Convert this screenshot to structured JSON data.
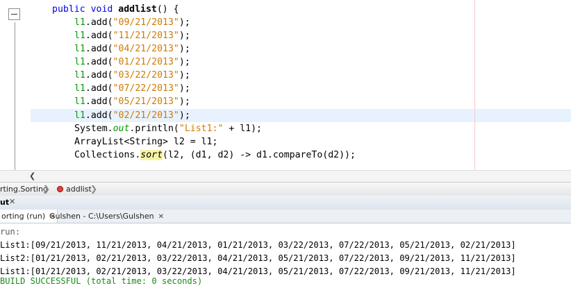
{
  "editor": {
    "lines": [
      {
        "indent": "    ",
        "modifiers": "public void ",
        "method_name": "addlist",
        "rest": "() {"
      },
      {
        "receiver": "l1",
        "call": ".add(",
        "arg": "\"09/21/2013\"",
        "end": ");"
      },
      {
        "receiver": "l1",
        "call": ".add(",
        "arg": "\"11/21/2013\"",
        "end": ");"
      },
      {
        "receiver": "l1",
        "call": ".add(",
        "arg": "\"04/21/2013\"",
        "end": ");"
      },
      {
        "receiver": "l1",
        "call": ".add(",
        "arg": "\"01/21/2013\"",
        "end": ");"
      },
      {
        "receiver": "l1",
        "call": ".add(",
        "arg": "\"03/22/2013\"",
        "end": ");"
      },
      {
        "receiver": "l1",
        "call": ".add(",
        "arg": "\"07/22/2013\"",
        "end": ");"
      },
      {
        "receiver": "l1",
        "call": ".add(",
        "arg": "\"05/21/2013\"",
        "end": ");"
      },
      {
        "receiver": "l1",
        "call": ".add(",
        "arg": "\"02/21/2013\"",
        "end": ");"
      }
    ],
    "println": {
      "prefix": "System.",
      "field": "out",
      "call": ".println(",
      "arg": "\"List1:\"",
      "rest": " + l1);"
    },
    "assign": "ArrayList<String> l2 = l1;",
    "sort": {
      "prefix": "Collections.",
      "method": "sort",
      "rest": "(l2, (d1, d2) -> d1.compareTo(d2));"
    }
  },
  "breadcrumb": {
    "class_label": "rting.Sorting",
    "method_label": "addlist"
  },
  "output_window": {
    "title": "ut",
    "tabs": [
      {
        "label": "orting (run)"
      },
      {
        "label": "Gulshen - C:\\Users\\Gulshen"
      }
    ],
    "console_lines": [
      "run:",
      "List1:[09/21/2013, 11/21/2013, 04/21/2013, 01/21/2013, 03/22/2013, 07/22/2013, 05/21/2013, 02/21/2013]",
      "List2:[01/21/2013, 02/21/2013, 03/22/2013, 04/21/2013, 05/21/2013, 07/22/2013, 09/21/2013, 11/21/2013]",
      "List1:[01/21/2013, 02/21/2013, 03/22/2013, 04/21/2013, 05/21/2013, 07/22/2013, 09/21/2013, 11/21/2013]"
    ],
    "build_status": "BUILD SUCCESSFUL (total time: 0 seconds)"
  },
  "colors": {
    "keyword": "#0000e6",
    "string": "#ce7b00",
    "field": "#009900",
    "build_success": "#1a8a1a",
    "current_line": "#e8f2fe"
  },
  "icons": [
    "fold-collapse-icon",
    "method-icon",
    "close-icon",
    "chevron-right-icon",
    "scroll-left-icon"
  ]
}
